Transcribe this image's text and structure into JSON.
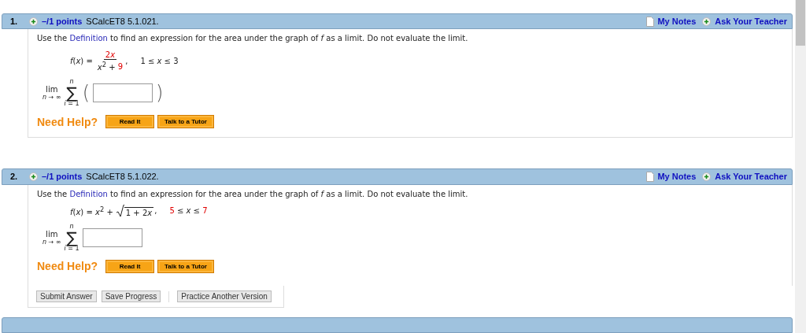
{
  "questions": [
    {
      "number": "1.",
      "points": "–/1 points",
      "code": "SCalcET8 5.1.021.",
      "my_notes": "My Notes",
      "ask_teacher": "Ask Your Teacher",
      "prompt_before": "Use the ",
      "prompt_link": "Definition",
      "prompt_after": " to find an expression for the area under the graph of *f* as a limit. Do not evaluate the limit.",
      "formula": {
        "kind": "fraction",
        "lhs": "*f*(*x*) =",
        "numerator": [
          {
            "text": "2",
            "highlight": true
          },
          {
            "text": "*x*",
            "highlight": true
          }
        ],
        "denominator": [
          {
            "text": "*x*$^{2}$ + ",
            "highlight": false
          },
          {
            "text": "9",
            "highlight": true
          }
        ],
        "separator": ",",
        "domain": [
          {
            "text": "1 ≤ *x* ≤ 3",
            "highlight": false
          }
        ]
      },
      "answer": {
        "lim": "lim",
        "lim_sub": "*n* → ∞",
        "sigma": "∑",
        "upper": "*n*",
        "lower": "*i* = 1",
        "open": "(",
        "close": ")"
      },
      "help": {
        "label": "Need Help?",
        "buttons": [
          "Read It",
          "Talk to a Tutor"
        ]
      }
    },
    {
      "number": "2.",
      "points": "–/1 points",
      "code": "SCalcET8 5.1.022.",
      "my_notes": "My Notes",
      "ask_teacher": "Ask Your Teacher",
      "prompt_before": "Use the ",
      "prompt_link": "Definition",
      "prompt_after": " to find an expression for the area under the graph of *f* as a limit. Do not evaluate the limit.",
      "formula": {
        "kind": "root",
        "lhs": "*f*(*x*) = *x*$^{2}$ +",
        "radicand": [
          {
            "text": "1 + 2",
            "highlight": false
          },
          {
            "text": "*x*",
            "highlight": false
          }
        ],
        "separator": ",",
        "domain": [
          {
            "text": "5",
            "highlight": true
          },
          {
            "text": " ≤ *x* ≤ ",
            "highlight": false
          },
          {
            "text": "7",
            "highlight": true
          }
        ]
      },
      "answer": {
        "lim": "lim",
        "lim_sub": "*n* → ∞",
        "sigma": "∑",
        "upper": "*n*",
        "lower": "*i* = 1"
      },
      "help": {
        "label": "Need Help?",
        "buttons": [
          "Read It",
          "Talk to a Tutor"
        ]
      },
      "footer": {
        "buttons": [
          "Submit Answer",
          "Save Progress"
        ],
        "extra_button": "Practice Another Version"
      }
    }
  ]
}
